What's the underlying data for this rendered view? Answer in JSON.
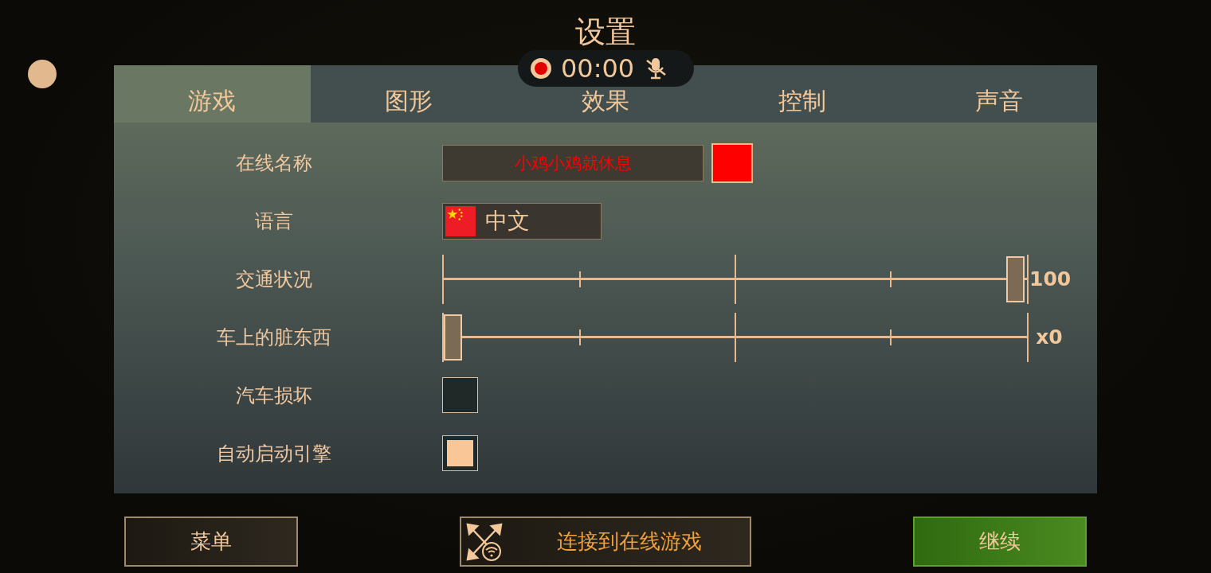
{
  "title": "设置",
  "recorder": {
    "time": "00:00",
    "recording": true,
    "mic_muted": true
  },
  "tabs": [
    {
      "label": "游戏",
      "selected": true
    },
    {
      "label": "图形",
      "selected": false
    },
    {
      "label": "效果",
      "selected": false
    },
    {
      "label": "控制",
      "selected": false
    },
    {
      "label": "声音",
      "selected": false
    }
  ],
  "settings": [
    {
      "kind": "name",
      "label": "在线名称",
      "value": "小鸡小鸡就休息",
      "color": "#ff0000"
    },
    {
      "kind": "language",
      "label": "语言",
      "value": "中文"
    },
    {
      "kind": "slider",
      "label": "交通状况",
      "level": 1,
      "reading": "100"
    },
    {
      "kind": "slider",
      "label": "车上的脏东西",
      "level": 0,
      "reading": "x0"
    },
    {
      "kind": "checkbox",
      "label": "汽车损坏",
      "checked": false
    },
    {
      "kind": "checkbox",
      "label": "自动启动引擎",
      "checked": true
    }
  ],
  "buttons": [
    {
      "kind": "menu",
      "label": "菜单"
    },
    {
      "kind": "online",
      "label": "连接到在线游戏"
    },
    {
      "kind": "continue",
      "label": "继续"
    }
  ]
}
